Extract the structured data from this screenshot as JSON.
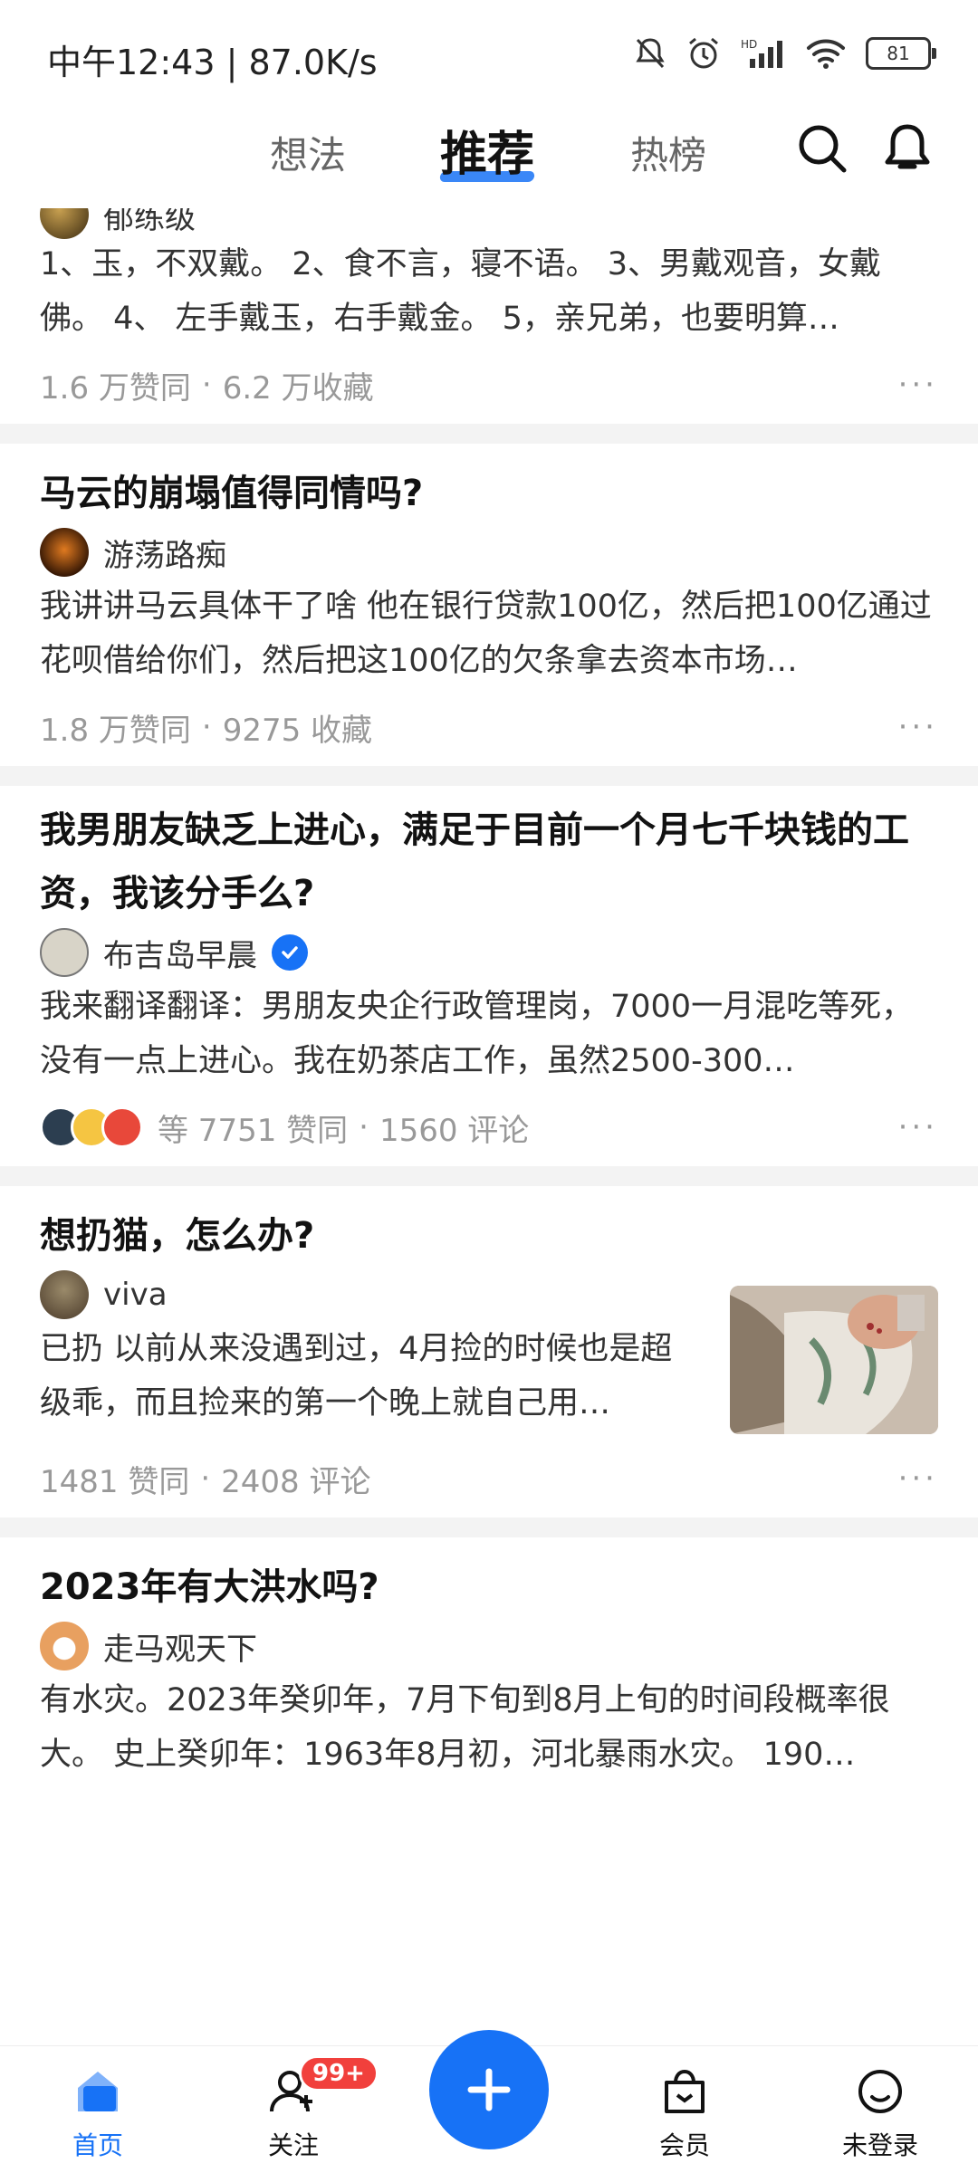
{
  "status_bar": {
    "time_speed": "中午12:43 | 87.0K/s",
    "battery": "81",
    "icons": [
      "mute-bell-icon",
      "alarm-icon",
      "signal-icon",
      "wifi-icon",
      "battery-icon"
    ]
  },
  "top_nav": {
    "tabs": [
      {
        "label": "想法"
      },
      {
        "label": "推荐"
      },
      {
        "label": "热榜"
      }
    ],
    "active_tab": "推荐",
    "accent_color": "#1772f6",
    "icons": [
      "search-icon",
      "bell-icon"
    ]
  },
  "feed": [
    {
      "title": "",
      "author": "郁练级",
      "excerpt": "1、玉，不双戴。 2、食不言，寝不语。 3、男戴观音，女戴佛。 4、 左手戴玉，右手戴金。 5，亲兄弟，也要明算…",
      "stat1": "1.6 万赞同",
      "stat2": "6.2 万收藏"
    },
    {
      "title": "马云的崩塌值得同情吗?",
      "author": "游荡路痴",
      "excerpt": "我讲讲马云具体干了啥 他在银行贷款100亿，然后把100亿通过花呗借给你们，然后把这100亿的欠条拿去资本市场…",
      "stat1": "1.8 万赞同",
      "stat2": "9275 收藏"
    },
    {
      "title": "我男朋友缺乏上进心，满足于目前一个月七千块钱的工资，我该分手么?",
      "author": "布吉岛早晨",
      "verified": true,
      "excerpt": "我来翻译翻译：男朋友央企行政管理岗，7000一月混吃等死，没有一点上进心。我在奶茶店工作，虽然2500-300…",
      "stat1": "等 7751 赞同",
      "stat2": "1560 评论"
    },
    {
      "title": "想扔猫，怎么办?",
      "author": "viva",
      "excerpt": "已扔 以前从来没遇到过，4月捡的时候也是超级乖，而且捡来的第一个晚上就自己用…",
      "stat1": "1481 赞同",
      "stat2": "2408 评论"
    },
    {
      "title": "2023年有大洪水吗?",
      "author": "走马观天下",
      "excerpt": "有水灾。2023年癸卯年，7月下旬到8月上旬的时间段概率很大。 史上癸卯年：1963年8月初，河北暴雨水灾。 190…"
    }
  ],
  "more_glyph": "···",
  "dot_sep": "·",
  "bottom_bar": {
    "home": "首页",
    "follow": "关注",
    "follow_badge": "99+",
    "vip": "会员",
    "profile": "未登录"
  }
}
